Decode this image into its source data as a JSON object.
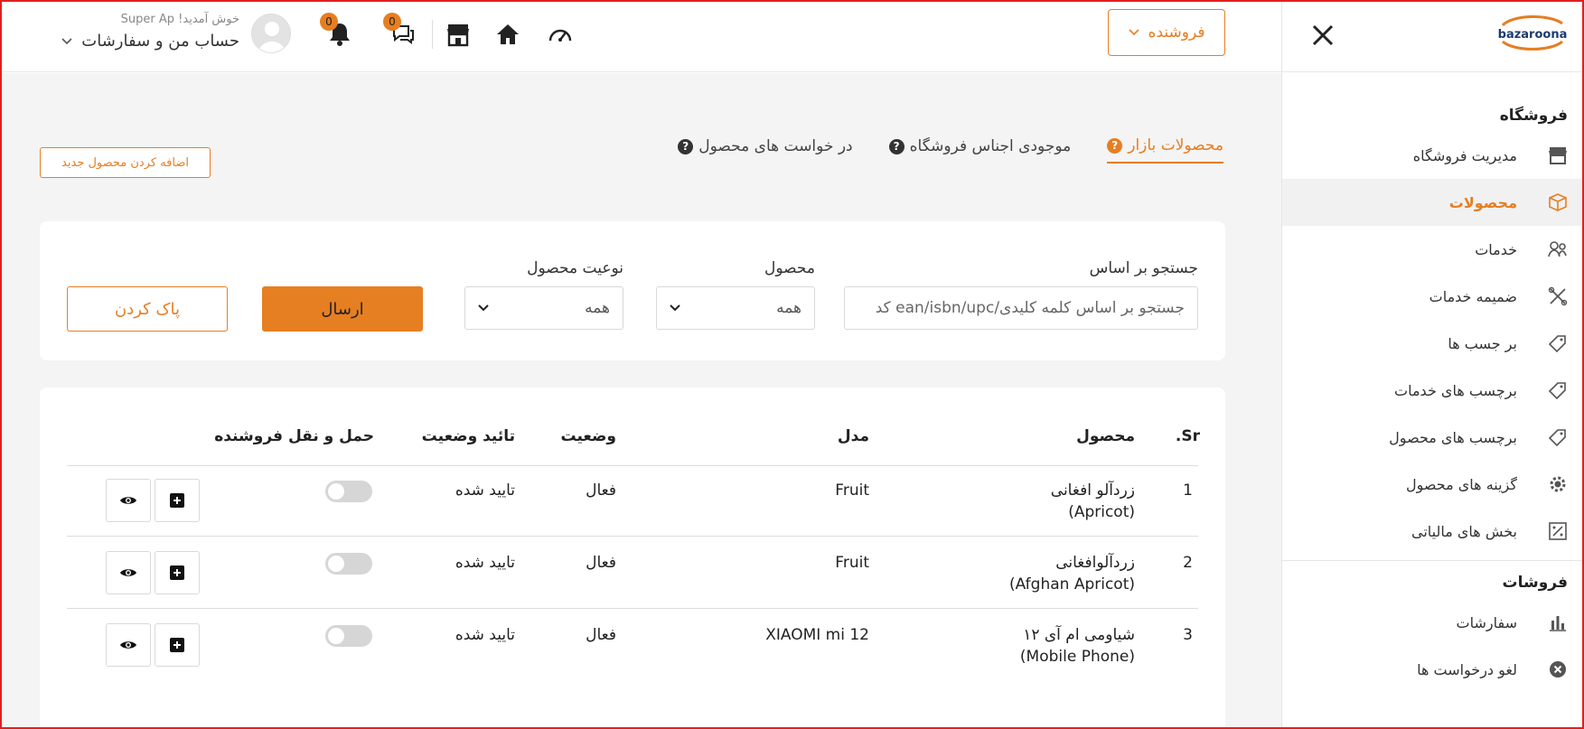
{
  "brand": {
    "name": "bazaroona"
  },
  "colors": {
    "accent": "#e67e22",
    "frame": "#e02020"
  },
  "header": {
    "role_label": "فروشنده",
    "welcome": "خوش آمدید! Super Ap",
    "account_label": "حساب من و سفارشات",
    "messages_count": "0",
    "notifications_count": "0",
    "icons": [
      "dashboard-icon",
      "home-icon",
      "store-icon",
      "chat-icon",
      "bell-icon",
      "avatar"
    ]
  },
  "sidebar": {
    "sections": [
      {
        "title": "فروشگاه",
        "items": [
          {
            "label": "مدیریت فروشگاه",
            "icon": "store-icon"
          },
          {
            "label": "محصولات",
            "icon": "box-icon",
            "active": true
          },
          {
            "label": "خدمات",
            "icon": "services-icon"
          },
          {
            "label": "ضمیمه خدمات",
            "icon": "tools-icon"
          },
          {
            "label": "بر جسب ها",
            "icon": "tag-icon"
          },
          {
            "label": "برچسب های خدمات",
            "icon": "tag-icon"
          },
          {
            "label": "برچسب های محصول",
            "icon": "tag-icon"
          },
          {
            "label": "گزینه های محصول",
            "icon": "gear-icon"
          },
          {
            "label": "بخش های مالیاتی",
            "icon": "tax-icon"
          }
        ]
      },
      {
        "title": "فروشات",
        "items": [
          {
            "label": "سفارشات",
            "icon": "chart-icon"
          },
          {
            "label": "لغو درخواست ها",
            "icon": "cancel-icon"
          }
        ]
      }
    ]
  },
  "tabs": [
    {
      "label": "محصولات بازار",
      "active": true
    },
    {
      "label": "موجودی اجناس فروشگاه"
    },
    {
      "label": "در خواست های محصول"
    }
  ],
  "add_button": "اضافه کردن محصول جدید",
  "filters": {
    "search_label": "جستجو بر اساس",
    "search_placeholder": "جستجو بر اساس کلمه کلیدی/ean/isbn/upc کد",
    "product_label": "محصول",
    "product_value": "همه",
    "type_label": "نوعیت محصول",
    "type_value": "همه",
    "submit": "ارسال",
    "clear": "پاک کردن"
  },
  "table": {
    "headers": {
      "sr": "Sr.",
      "product": "محصول",
      "model": "مدل",
      "status": "وضعیت",
      "approval": "تائید وضعیت",
      "shipping": "حمل و نقل فروشنده"
    },
    "rows": [
      {
        "sr": "1",
        "product": "زردآلو افغانی",
        "product_en": "(Apricot)",
        "model": "Fruit",
        "status": "فعال",
        "approval": "تایید شده"
      },
      {
        "sr": "2",
        "product": "زردآلوافغانی",
        "product_en": "(Afghan Apricot)",
        "model": "Fruit",
        "status": "فعال",
        "approval": "تایید شده"
      },
      {
        "sr": "3",
        "product": "شیاومی ام آی ۱۲",
        "product_en": "(Mobile Phone)",
        "model": "XIAOMI mi 12",
        "status": "فعال",
        "approval": "تایید شده"
      }
    ]
  }
}
